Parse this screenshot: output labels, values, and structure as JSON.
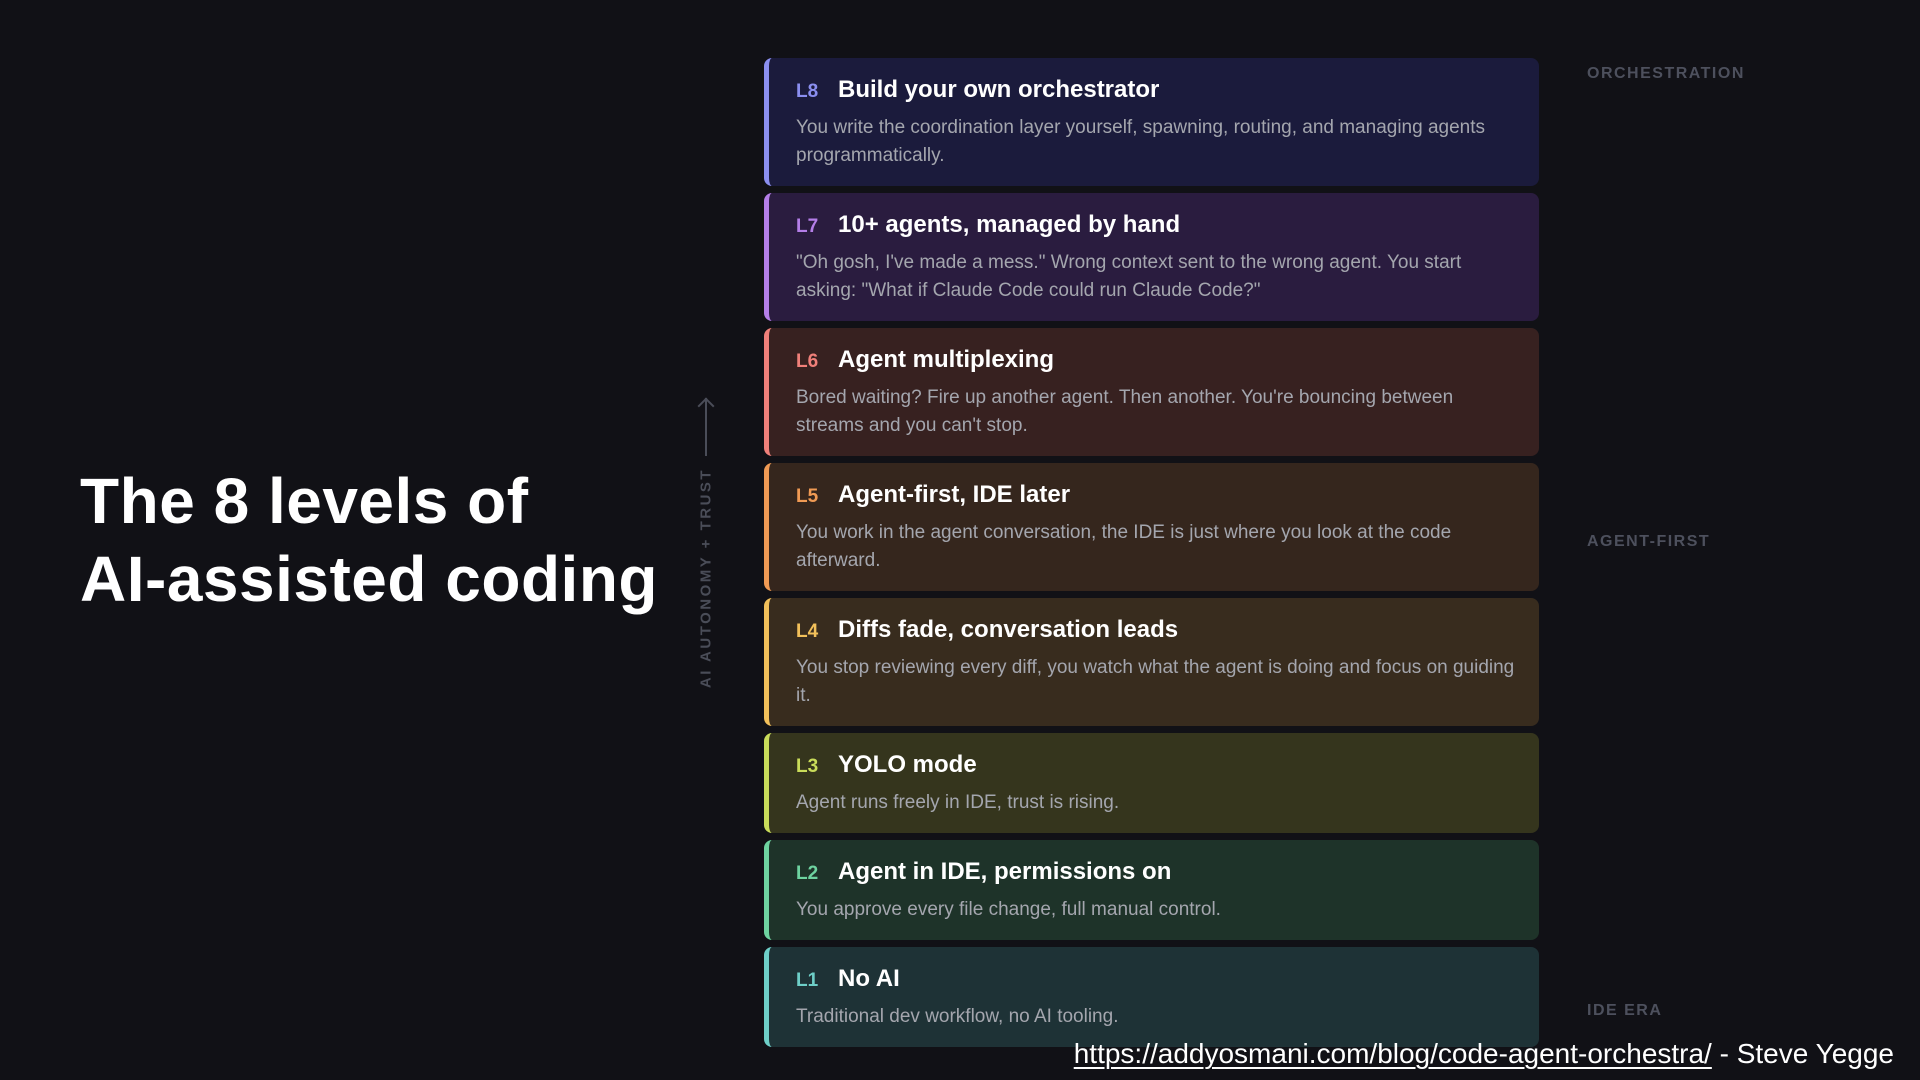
{
  "title": {
    "line1": "The 8 levels of",
    "line2": "AI-assisted coding"
  },
  "axis": {
    "label": "AI AUTONOMY + TRUST",
    "icon": "arrow-up-icon"
  },
  "levels": [
    {
      "code": "L8",
      "title": "Build your own orchestrator",
      "description": "You write the coordination layer yourself, spawning, routing, and managing agents programmatically.",
      "accent": "#8b8ff0",
      "background": "#1b1b3c"
    },
    {
      "code": "L7",
      "title": "10+ agents, managed by hand",
      "description": "\"Oh gosh, I've made a mess.\" Wrong context sent to the wrong agent. You start asking: \"What if Claude Code could run Claude Code?\"",
      "accent": "#b47ee8",
      "background": "#2a1c3f"
    },
    {
      "code": "L6",
      "title": "Agent multiplexing",
      "description": "Bored waiting? Fire up another agent. Then another. You're bouncing between streams and you can't stop.",
      "accent": "#f0807a",
      "background": "#372120"
    },
    {
      "code": "L5",
      "title": "Agent-first, IDE later",
      "description": "You work in the agent conversation, the IDE is just where you look at the code afterward.",
      "accent": "#f09a54",
      "background": "#35261d"
    },
    {
      "code": "L4",
      "title": "Diffs fade, conversation leads",
      "description": "You stop reviewing every diff, you watch what the agent is doing and focus on guiding it.",
      "accent": "#f2c05a",
      "background": "#382c1e"
    },
    {
      "code": "L3",
      "title": "YOLO mode",
      "description": "Agent runs freely in IDE, trust is rising.",
      "accent": "#c9dc5a",
      "background": "#35351d"
    },
    {
      "code": "L2",
      "title": "Agent in IDE, permissions on",
      "description": "You approve every file change, full manual control.",
      "accent": "#6ed3a0",
      "background": "#1e3329"
    },
    {
      "code": "L1",
      "title": "No AI",
      "description": "Traditional dev workflow, no AI tooling.",
      "accent": "#6ecfc8",
      "background": "#1e3236"
    }
  ],
  "eras": {
    "orchestration": "ORCHESTRATION",
    "agent_first": "AGENT-FIRST",
    "ide_era": "IDE ERA"
  },
  "credit": {
    "url": "https://addyosmani.com/blog/code-agent-orchestra/",
    "author": " - Steve Yegge"
  }
}
